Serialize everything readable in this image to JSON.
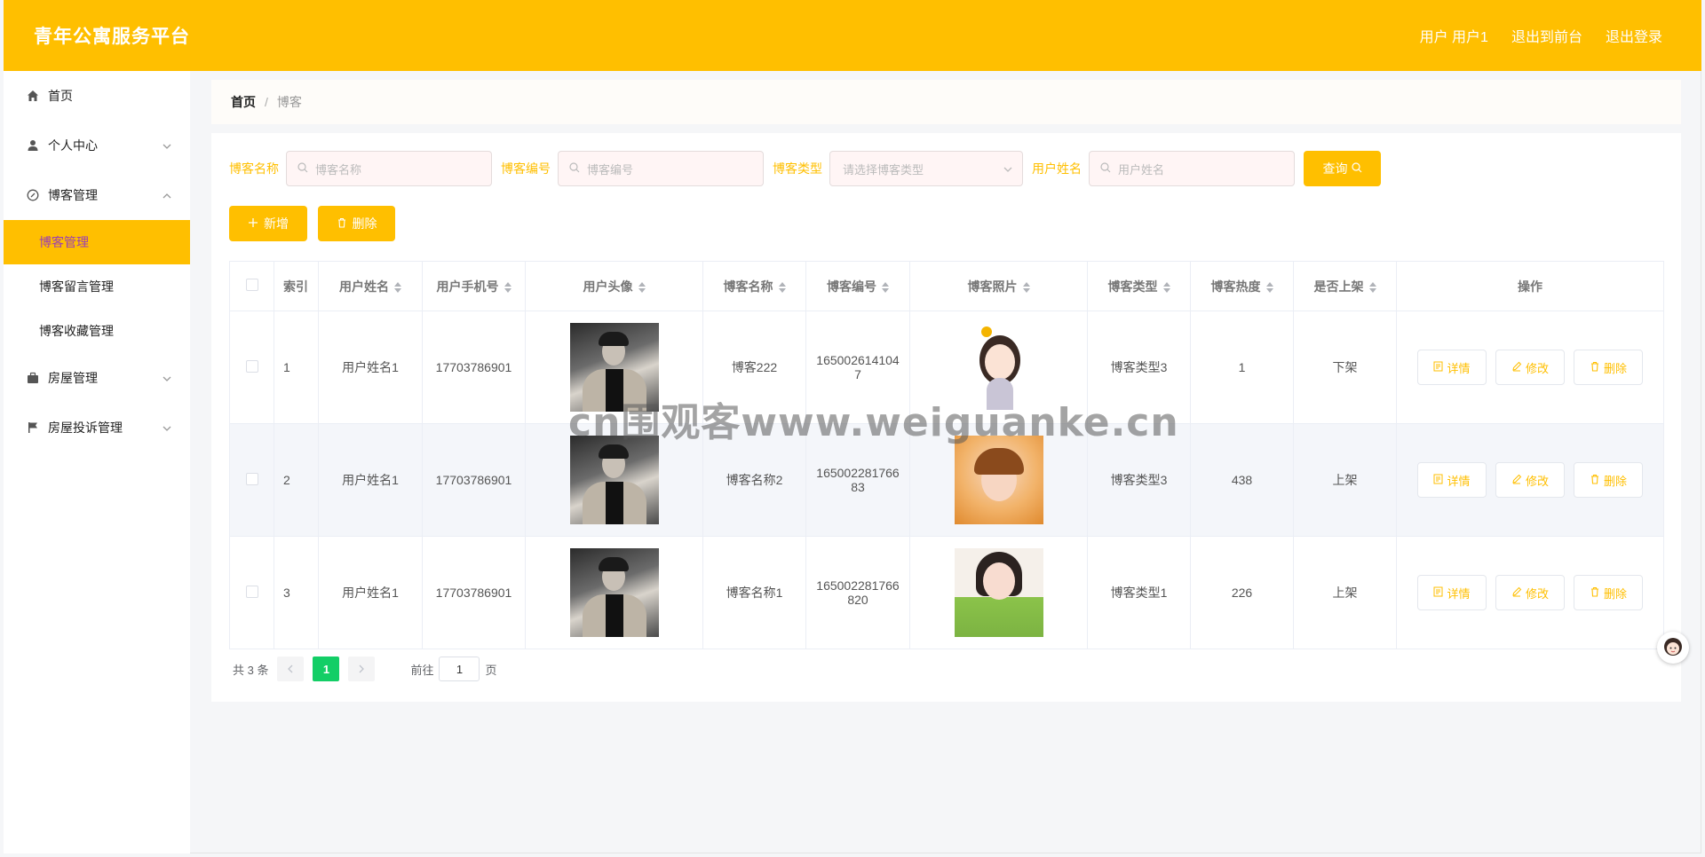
{
  "app": {
    "title": "青年公寓服务平台"
  },
  "header": {
    "user_label": "用户 用户1",
    "front_label": "退出到前台",
    "logout_label": "退出登录"
  },
  "sidebar": {
    "items": [
      {
        "label": "首页",
        "icon": "home-icon"
      },
      {
        "label": "个人中心",
        "icon": "user-icon"
      },
      {
        "label": "博客管理",
        "icon": "compass-icon"
      },
      {
        "label": "房屋管理",
        "icon": "briefcase-icon"
      },
      {
        "label": "房屋投诉管理",
        "icon": "flag-icon"
      }
    ],
    "sub_items": [
      {
        "label": "博客管理"
      },
      {
        "label": "博客留言管理"
      },
      {
        "label": "博客收藏管理"
      }
    ]
  },
  "breadcrumb": {
    "home": "首页",
    "sep": "/",
    "current": "博客"
  },
  "search": {
    "name_label": "博客名称",
    "name_placeholder": "博客名称",
    "code_label": "博客编号",
    "code_placeholder": "博客编号",
    "type_label": "博客类型",
    "type_placeholder": "请选择博客类型",
    "user_label": "用户姓名",
    "user_placeholder": "用户姓名",
    "query_label": "查询"
  },
  "actions": {
    "add_label": "新增",
    "delete_label": "删除"
  },
  "table": {
    "headers": [
      "索引",
      "用户姓名",
      "用户手机号",
      "用户头像",
      "博客名称",
      "博客编号",
      "博客照片",
      "博客类型",
      "博客热度",
      "是否上架",
      "操作"
    ],
    "rows": [
      {
        "index": "1",
        "user": "用户姓名1",
        "phone": "17703786901",
        "name": "博客222",
        "code": "1650026141047",
        "type": "博客类型3",
        "heat": "1",
        "status": "下架"
      },
      {
        "index": "2",
        "user": "用户姓名1",
        "phone": "17703786901",
        "name": "博客名称2",
        "code": "16500228176683",
        "type": "博客类型3",
        "heat": "438",
        "status": "上架"
      },
      {
        "index": "3",
        "user": "用户姓名1",
        "phone": "17703786901",
        "name": "博客名称1",
        "code": "165002281766820",
        "type": "博客类型1",
        "heat": "226",
        "status": "上架"
      }
    ],
    "op_labels": {
      "detail": "详情",
      "edit": "修改",
      "delete": "删除"
    }
  },
  "pager": {
    "total": "共 3 条",
    "current_page": "1",
    "goto": "前往",
    "page_value": "1",
    "page_suffix": "页"
  },
  "watermark": "cn围观客www.weiguanke.cn",
  "colors": {
    "accent": "#ffbf00",
    "pager_active": "#13ce66"
  }
}
